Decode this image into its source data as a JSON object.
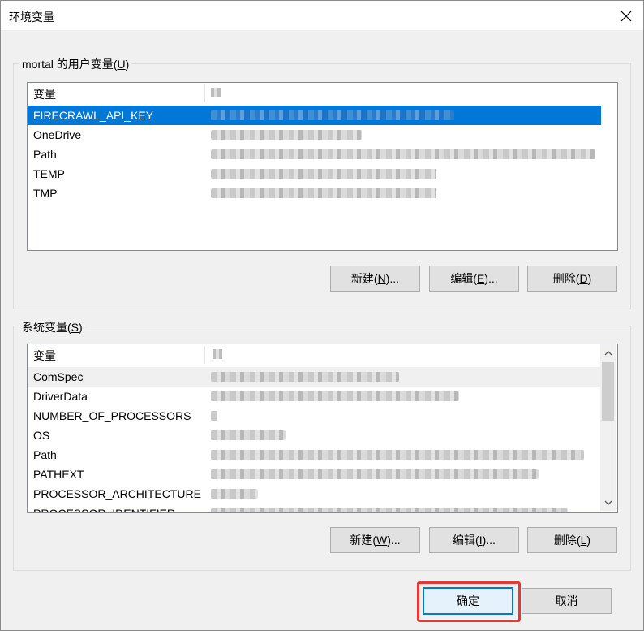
{
  "window": {
    "title": "环境变量",
    "close_icon": "close-icon"
  },
  "user_group": {
    "label_prefix": "mortal 的用户变量(",
    "label_key": "U",
    "label_suffix": ")",
    "header_name": "变量",
    "rows": [
      {
        "name": "FIRECRAWL_API_KEY"
      },
      {
        "name": "OneDrive"
      },
      {
        "name": "Path"
      },
      {
        "name": "TEMP"
      },
      {
        "name": "TMP"
      }
    ],
    "buttons": {
      "new_pre": "新建(",
      "new_key": "N",
      "new_post": ")...",
      "edit_pre": "编辑(",
      "edit_key": "E",
      "edit_post": ")...",
      "delete_pre": "删除(",
      "delete_key": "D",
      "delete_post": ")"
    }
  },
  "system_group": {
    "label_prefix": "系统变量(",
    "label_key": "S",
    "label_suffix": ")",
    "header_name": "变量",
    "rows": [
      {
        "name": "ComSpec"
      },
      {
        "name": "DriverData"
      },
      {
        "name": "NUMBER_OF_PROCESSORS"
      },
      {
        "name": "OS"
      },
      {
        "name": "Path"
      },
      {
        "name": "PATHEXT"
      },
      {
        "name": "PROCESSOR_ARCHITECTURE"
      },
      {
        "name": "PROCESSOR_IDENTIFIER"
      }
    ],
    "buttons": {
      "new_pre": "新建(",
      "new_key": "W",
      "new_post": ")...",
      "edit_pre": "编辑(",
      "edit_key": "I",
      "edit_post": ")...",
      "delete_pre": "删除(",
      "delete_key": "L",
      "delete_post": ")"
    }
  },
  "footer": {
    "ok_label": "确定",
    "cancel_label": "取消"
  },
  "colors": {
    "selection": "#0078d7",
    "highlight_box": "#e53935"
  }
}
